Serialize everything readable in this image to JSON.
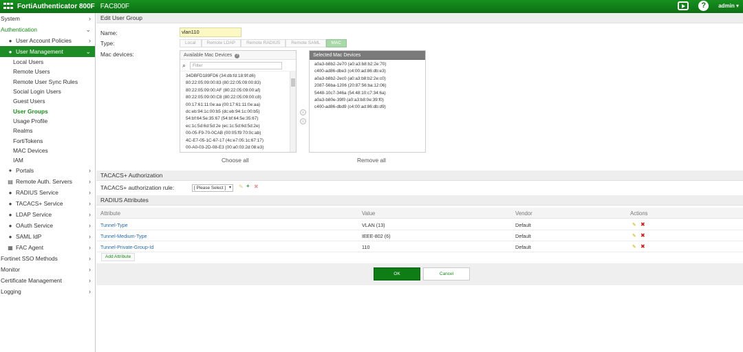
{
  "topbar": {
    "product": "FortiAuthenticator 800F",
    "hostname": "FAC800F",
    "user": "admin ▾"
  },
  "sidebar": {
    "items": [
      {
        "label": "System",
        "level": 0,
        "chevron": "›"
      },
      {
        "label": "Authentication",
        "level": 0,
        "chevron": "⌄",
        "state": "green"
      },
      {
        "label": "User Account Policies",
        "level": 1,
        "chevron": "›",
        "icon": "user-icon"
      },
      {
        "label": "User Management",
        "level": 1,
        "chevron": "⌄",
        "icon": "user-icon",
        "state": "active"
      },
      {
        "label": "Local Users",
        "level": 2
      },
      {
        "label": "Remote Users",
        "level": 2
      },
      {
        "label": "Remote User Sync Rules",
        "level": 2
      },
      {
        "label": "Social Login Users",
        "level": 2
      },
      {
        "label": "Guest Users",
        "level": 2
      },
      {
        "label": "User Groups",
        "level": 2,
        "state": "selected"
      },
      {
        "label": "Usage Profile",
        "level": 2
      },
      {
        "label": "Realms",
        "level": 2
      },
      {
        "label": "FortiTokens",
        "level": 2
      },
      {
        "label": "MAC Devices",
        "level": 2
      },
      {
        "label": "IAM",
        "level": 2
      },
      {
        "label": "Portals",
        "level": 1,
        "chevron": "›",
        "icon": "portal-icon"
      },
      {
        "label": "Remote Auth. Servers",
        "level": 1,
        "chevron": "›",
        "icon": "server-icon"
      },
      {
        "label": "RADIUS Service",
        "level": 1,
        "chevron": "›",
        "icon": "user-icon"
      },
      {
        "label": "TACACS+ Service",
        "level": 1,
        "chevron": "›",
        "icon": "user-icon"
      },
      {
        "label": "LDAP Service",
        "level": 1,
        "chevron": "›",
        "icon": "user-icon"
      },
      {
        "label": "OAuth Service",
        "level": 1,
        "chevron": "›",
        "icon": "user-icon"
      },
      {
        "label": "SAML IdP",
        "level": 1,
        "chevron": "›",
        "icon": "user-icon"
      },
      {
        "label": "FAC Agent",
        "level": 1,
        "chevron": "›",
        "icon": "agent-icon"
      },
      {
        "label": "Fortinet SSO Methods",
        "level": 0,
        "chevron": "›"
      },
      {
        "label": "Monitor",
        "level": 0,
        "chevron": "›"
      },
      {
        "label": "Certificate Management",
        "level": 0,
        "chevron": "›"
      },
      {
        "label": "Logging",
        "level": 0,
        "chevron": "›"
      }
    ]
  },
  "form": {
    "section_title": "Edit User Group",
    "name_label": "Name:",
    "name_value": "vlan110",
    "type_label": "Type:",
    "types": [
      "Local",
      "Remote LDAP",
      "Remote RADIUS",
      "Remote SAML",
      "MAC"
    ],
    "mac_label": "Mac devices:",
    "available_title": "Available Mac Devices",
    "filter_placeholder": "Filter",
    "available_devices": [
      "34DBFD189FD6 (34:db:fd:18:9f:d6)",
      "80:22:05:09:00:83 (80:22:05:09:00:83)",
      "80:22:05:09:00:AF (80:22:05:09:00:af)",
      "80:22:05:09:00:C8 (80:22:05:09:00:c8)",
      "00:17:61:11:0e:aa (00:17:61:11:0e:aa)",
      "dc:eb:94:1c:00:b5 (dc:eb:94:1c:00:b5)",
      "54:bf:64:5e:35:67 (54:bf:64:5e:35:67)",
      "ec:1c:5d:6d:5d:2e (ec:1c:5d:6d:5d:2e)",
      "00-05-F9-70-0CAB (00:05:f9:70:0c:ab)",
      "4C-E7-05-1C-67-17 (4c:e7:05:1c:67:17)",
      "00-A0-03-2D-08-E3 (00:a0:03:2d:08:e3)"
    ],
    "selected_title": "Selected Mac Devices",
    "selected_devices": [
      "a0a3-b8b2-2e70 (a0:a3:b8:b2:2e:70)",
      "c400-ad86-dbe3 (c4:00:ad:86:db:e3)",
      "a0a3-b8b2-2ec0 (a0:a3:b8:b2:2e:c0)",
      "2087-56ba-1206 (20:87:56:ba:12:06)",
      "5448-10c7-346a (54:48:10:c7:34:6a)",
      "a0a3-b80e-39f0 (a0:a3:b8:0e:39:f0)",
      "c400-ad86-dbd9 (c4:00:ad:86:db:d9)"
    ],
    "choose_all": "Choose all",
    "remove_all": "Remove all"
  },
  "tacacs": {
    "section_title": "TACACS+ Authorization",
    "rule_label": "TACACS+ authorization rule:",
    "rule_value": "[ Please Select ]"
  },
  "radius": {
    "section_title": "RADIUS Attributes",
    "columns": [
      "Attribute",
      "Value",
      "Vendor",
      "Actions"
    ],
    "rows": [
      {
        "attribute": "Tunnel-Type",
        "value": "VLAN (13)",
        "vendor": "Default"
      },
      {
        "attribute": "Tunnel-Medium-Type",
        "value": "IEEE-802 (6)",
        "vendor": "Default"
      },
      {
        "attribute": "Tunnel-Private-Group-Id",
        "value": "110",
        "vendor": "Default"
      }
    ],
    "add_label": "Add Attribute"
  },
  "buttons": {
    "ok": "OK",
    "cancel": "Cancel"
  },
  "colors": {
    "brand_green": "#0d6f15",
    "active_nav": "#1e8c25",
    "name_field": "#fbf8c4"
  }
}
